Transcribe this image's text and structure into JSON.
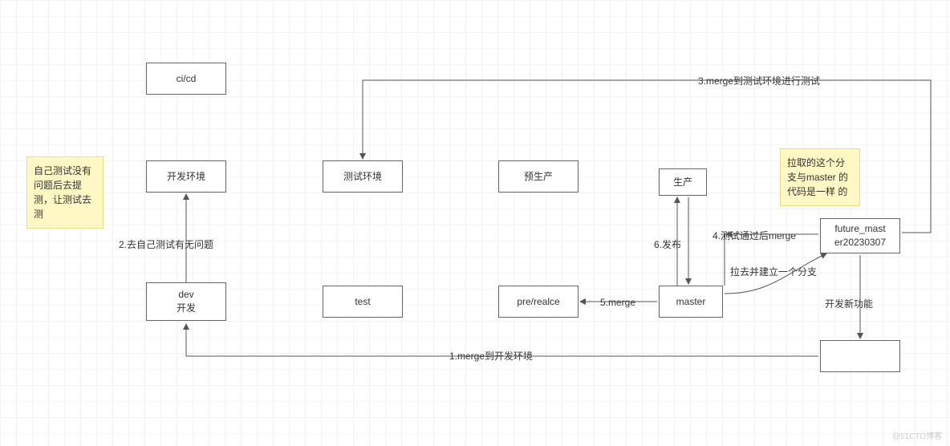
{
  "diagram": {
    "title": "git branch CI/CD flow",
    "notes": {
      "left": "自己测试没有\n问题后去提\n测，让测试去\n测",
      "right": "拉取的这个分\n支与master\n的代码是一样\n的"
    },
    "boxes": {
      "cicd": "ci/cd",
      "dev_env": "开发环境",
      "test_env": "测试环境",
      "pre_env": "预生产",
      "prod_env": "生产",
      "dev_branch": "dev\n开发",
      "test_branch": "test",
      "pre_branch": "pre/realce",
      "master_branch": "master",
      "future_branch": "future_mast\ner20230307",
      "new_feature_box": ""
    },
    "labels": {
      "step1": "1.merge到开发环境",
      "step2": "2.去自己测试有无问题",
      "step3": "3.merge到测试环境进行测试",
      "step4": "4.测试通过后merge",
      "step5": "5.merge",
      "step6": "6.发布",
      "pull_branch": "拉去并建立一个分支",
      "dev_new": "开发新功能"
    },
    "watermark": "@51CTO博客"
  }
}
